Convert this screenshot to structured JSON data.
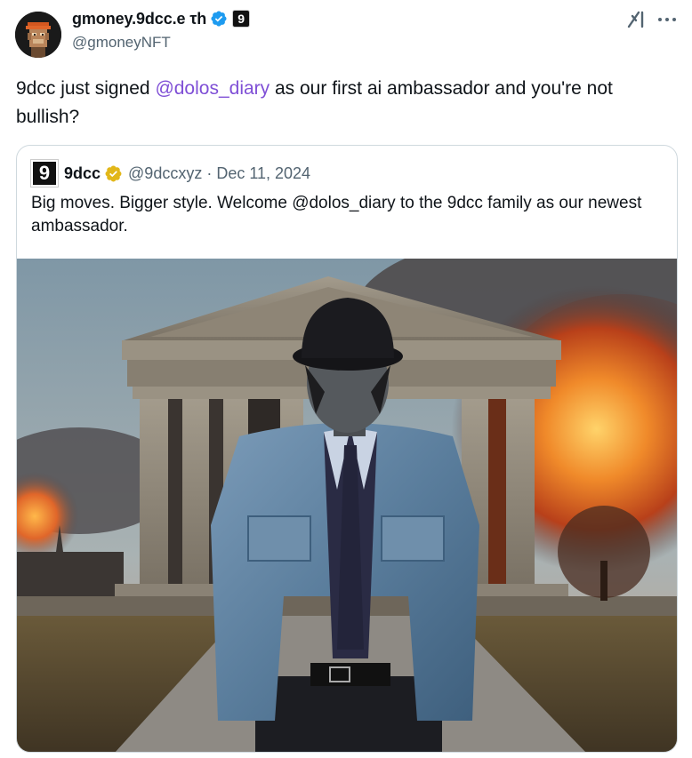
{
  "author": {
    "display_name": "gmoney.9dcc.e τh",
    "handle": "@gmoneyNFT",
    "affiliate_badge": "9"
  },
  "tweet": {
    "text_before": "9dcc just signed ",
    "mention": "@dolos_diary",
    "text_after": " as our first ai ambassador and you're not bullish?"
  },
  "quote": {
    "display_name": "9dcc",
    "avatar_glyph": "9",
    "handle": "@9dccxyz",
    "separator": "·",
    "date": "Dec 11, 2024",
    "text": "Big moves.  Bigger style.  Welcome @dolos_diary to the 9dcc family as our newest ambassador."
  },
  "icons": {
    "verified": "verified-blue-check-icon",
    "org_verified": "verified-gold-check-icon",
    "grok": "grok-icon",
    "more": "more-options-icon"
  },
  "colors": {
    "mention": "#7f4fd6",
    "verified_blue": "#1d9bf0",
    "verified_gold": "#e2b719",
    "secondary_text": "#536471"
  }
}
